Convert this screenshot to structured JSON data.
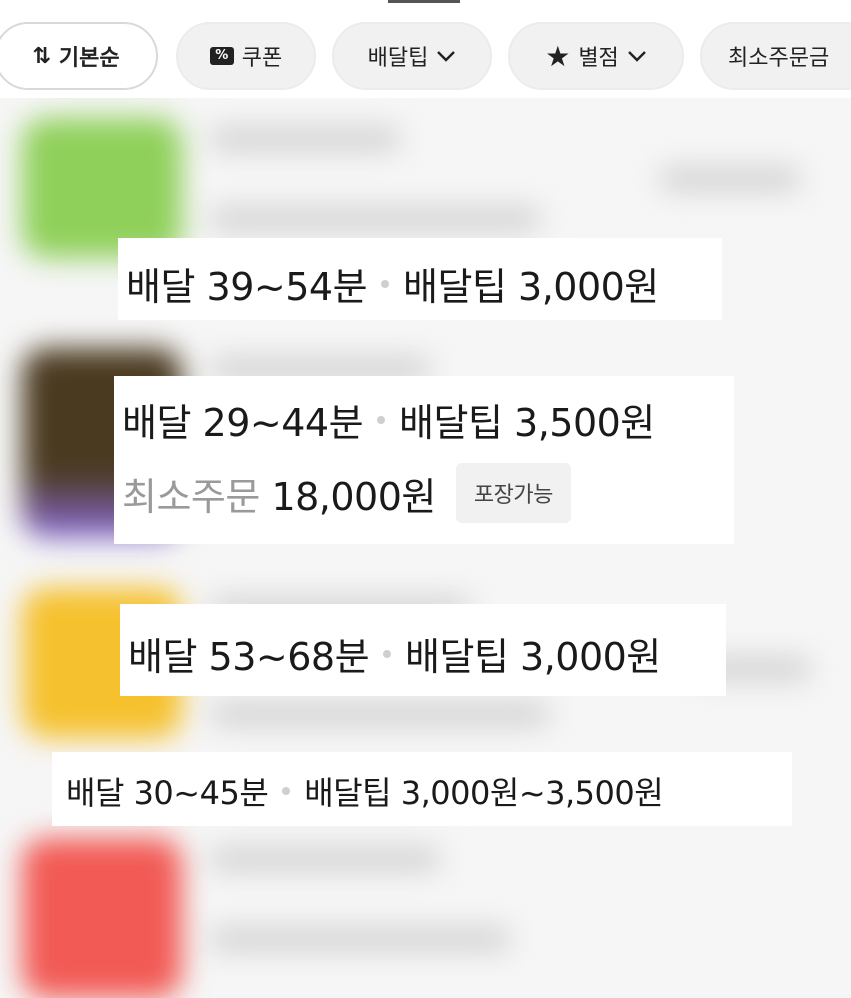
{
  "filters": {
    "sort": {
      "label": "기본순",
      "icon": "sort-arrows-icon"
    },
    "coupon": {
      "label": "쿠폰",
      "icon": "coupon-icon"
    },
    "delivery_tip": {
      "label": "배달팁",
      "icon": "chevron-down-icon"
    },
    "rating": {
      "label": "별점",
      "icon": "star-icon"
    },
    "min_order": {
      "label": "최소주문금"
    }
  },
  "stores": [
    {
      "delivery_label": "배달",
      "time": "39~54분",
      "tip_label": "배달팁",
      "tip": "3,000원"
    },
    {
      "delivery_label": "배달",
      "time": "29~44분",
      "tip_label": "배달팁",
      "tip": "3,500원",
      "min_order_label": "최소주문",
      "min_order": "18,000원",
      "badge": "포장가능"
    },
    {
      "delivery_label": "배달",
      "time": "53~68분",
      "tip_label": "배달팁",
      "tip": "3,000원"
    },
    {
      "delivery_label": "배달",
      "time": "30~45분",
      "tip_label": "배달팁",
      "tip": "3,000원~3,500원"
    }
  ],
  "colors": {
    "thumb1": "#8fd05a",
    "thumb2": "#4a3a20",
    "thumb2_bottom": "#8a6ad8",
    "thumb3": "#f5c12e",
    "thumb4": "#f25a55"
  }
}
